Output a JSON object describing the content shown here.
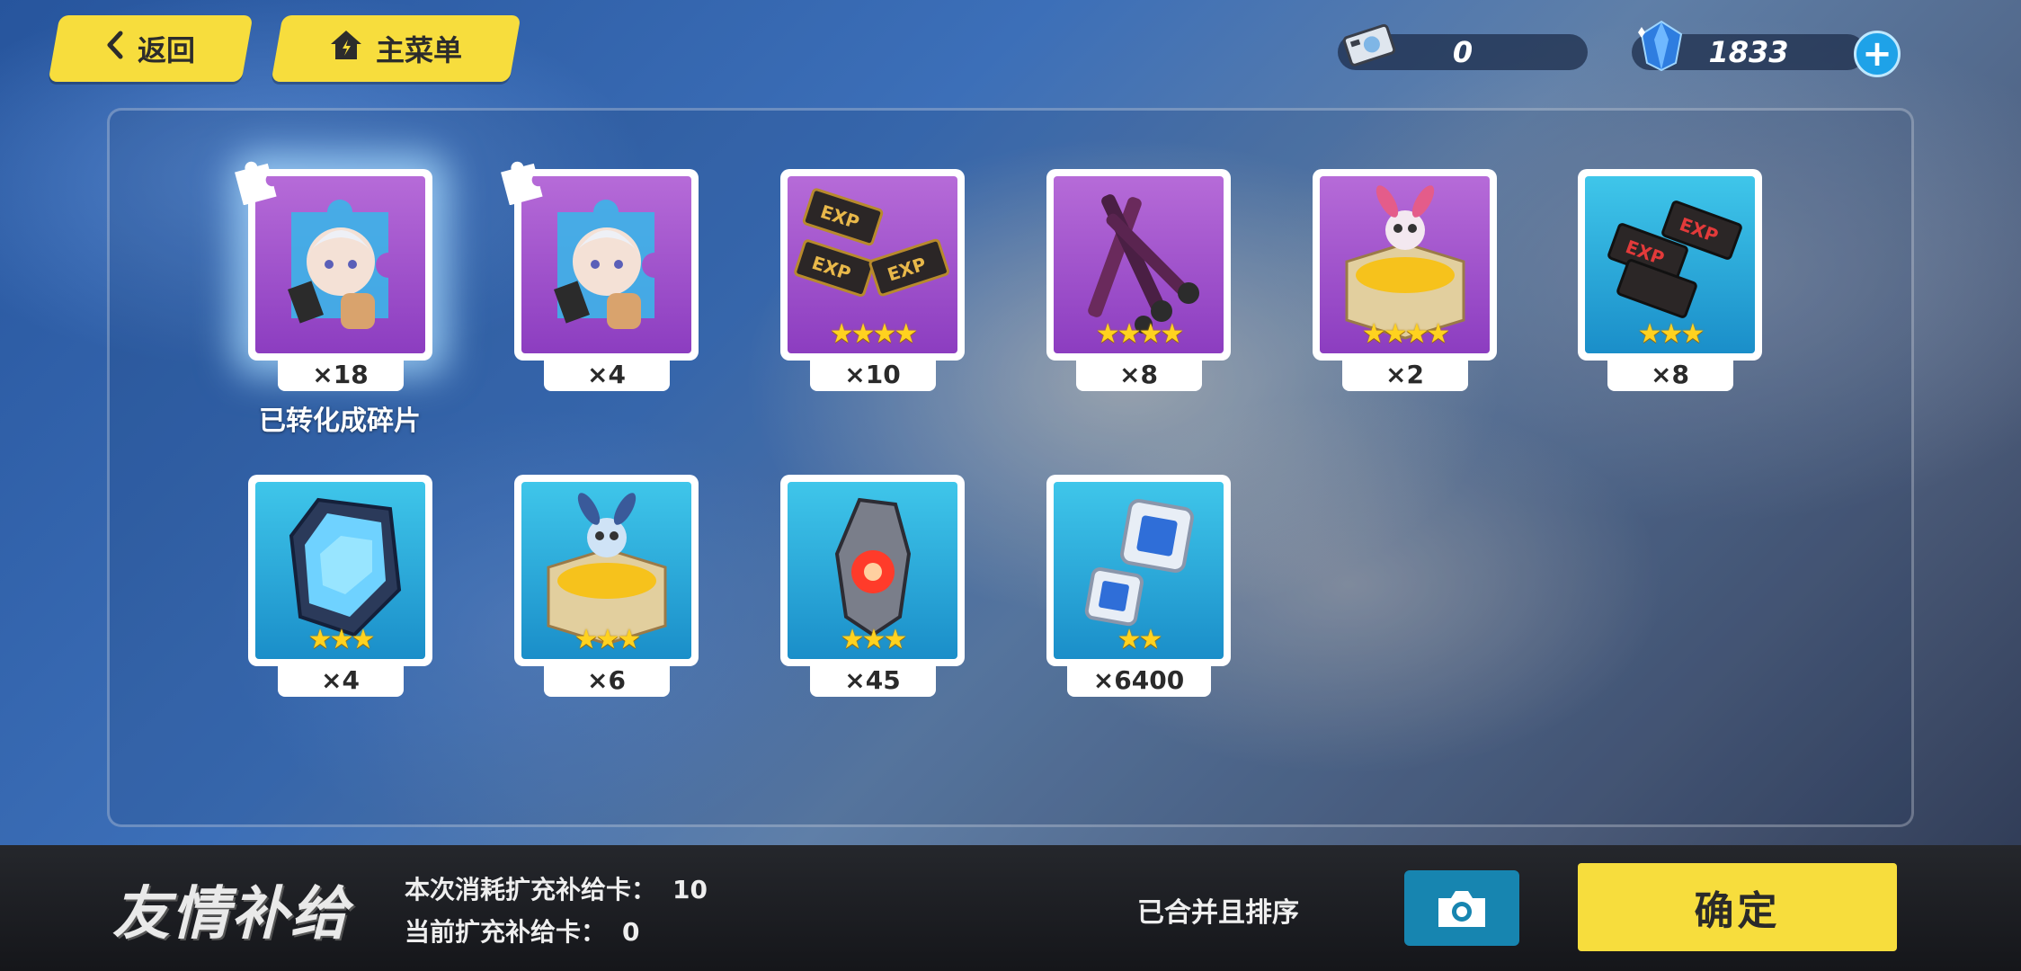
{
  "top_nav": {
    "back_label": "返回",
    "main_menu_label": "主菜单"
  },
  "currencies": {
    "cards": "0",
    "crystals": "1833",
    "add_symbol": "+"
  },
  "rewards": [
    {
      "name": "角色碎片",
      "icon": "puzzle-piece-character",
      "bg": "purple",
      "stars": "",
      "qty": "×18",
      "note": "已转化成碎片"
    },
    {
      "name": "角色碎片",
      "icon": "puzzle-piece-character",
      "bg": "purple",
      "stars": "",
      "qty": "×4"
    },
    {
      "name": "EXP芯片",
      "icon": "exp-chips-gold",
      "bg": "purple",
      "stars": "★★★★",
      "qty": "×10"
    },
    {
      "name": "武器材料",
      "icon": "purple-crossed-keys",
      "bg": "purple",
      "stars": "★★★★",
      "qty": "×8"
    },
    {
      "name": "金币箱",
      "icon": "gold-box-pink-bunny",
      "bg": "purple",
      "stars": "★★★★",
      "qty": "×2"
    },
    {
      "name": "EXP芯片",
      "icon": "exp-chips-red",
      "bg": "blue",
      "stars": "★★★",
      "qty": "×8"
    },
    {
      "name": "盾牌材料",
      "icon": "blue-crystal-shield",
      "bg": "blue",
      "stars": "★★★",
      "qty": "×4"
    },
    {
      "name": "金币箱",
      "icon": "gold-box-blue-bunny",
      "bg": "blue",
      "stars": "★★★",
      "qty": "×6"
    },
    {
      "name": "红色结晶",
      "icon": "red-crystal",
      "bg": "blue",
      "stars": "★★★",
      "qty": "×45"
    },
    {
      "name": "金币",
      "icon": "silver-square-coins",
      "bg": "blue",
      "stars": "★★",
      "qty": "×6400"
    }
  ],
  "bottom": {
    "title": "友情补给",
    "consume_label": "本次消耗扩充补给卡：",
    "consume_value": "10",
    "current_label": "当前扩充补给卡：",
    "current_value": "0",
    "sorted_label": "已合并且排序",
    "confirm_label": "确定"
  },
  "colors": {
    "accent_yellow": "#f7dd3d",
    "card_purple": "#9c4fcc",
    "card_blue": "#27a8db",
    "camera_blue": "#1785b0"
  }
}
